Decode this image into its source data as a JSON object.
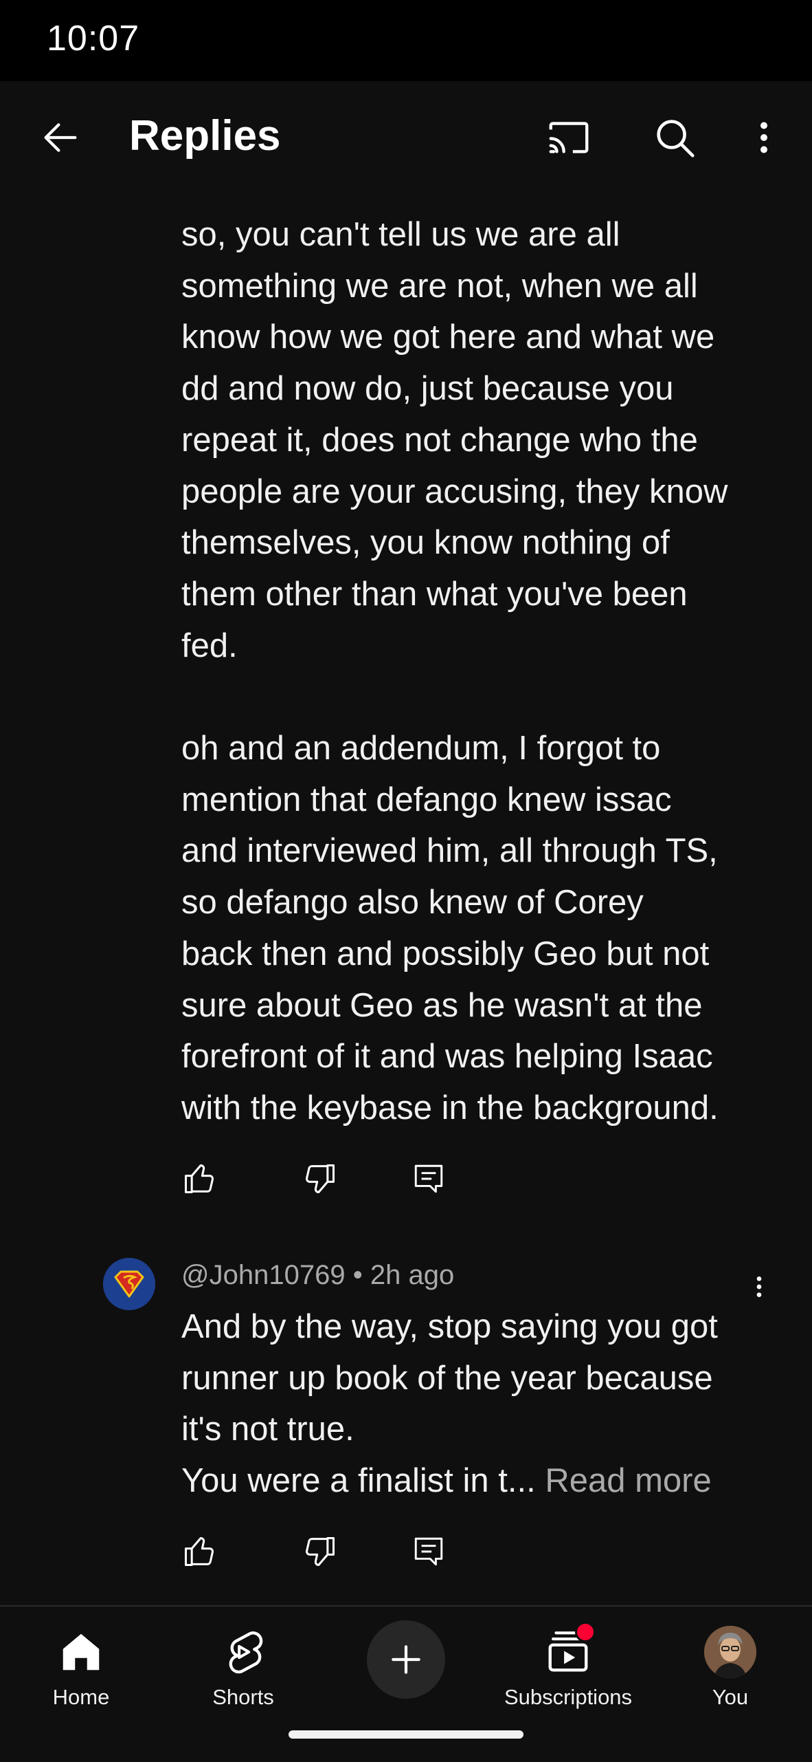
{
  "status_bar": {
    "time": "10:07"
  },
  "header": {
    "title": "Replies",
    "icons": [
      "back-arrow-icon",
      "cast-icon",
      "search-icon",
      "more-vert-icon"
    ]
  },
  "comment_1": {
    "paragraph_1": [
      "so, you can't tell us we are all",
      "something we are not, when we all",
      "know how we got here and what we",
      "dd and now do, just because you",
      "repeat it, does not change who the",
      "people are your accusing, they know",
      "themselves, you know nothing of",
      "them other than what you've been",
      "fed."
    ],
    "paragraph_2": [
      "oh and an addendum, I forgot to",
      "mention that defango knew issac",
      "and interviewed him, all through TS,",
      "so defango also knew of Corey",
      "back then and possibly Geo but not",
      "sure about Geo as he wasn't at the",
      "forefront of it and was helping Isaac",
      "with the keybase in the background."
    ],
    "actions": [
      "like-icon",
      "dislike-icon",
      "reply-icon"
    ]
  },
  "comment_2": {
    "author": "@John10769",
    "separator": "•",
    "time": "2h ago",
    "lines": [
      "And by the way, stop saying you got",
      "runner up book of the year because",
      "it's not true."
    ],
    "last_line": "You were a finalist in t...",
    "read_more": "Read more",
    "actions": [
      "like-icon",
      "dislike-icon",
      "reply-icon"
    ]
  },
  "bottom_nav": {
    "items": [
      {
        "label": "Home",
        "icon": "home-icon"
      },
      {
        "label": "Shorts",
        "icon": "shorts-icon"
      },
      {
        "label": "",
        "icon": "create-plus-icon"
      },
      {
        "label": "Subscriptions",
        "icon": "subscriptions-icon"
      },
      {
        "label": "You",
        "icon": "profile-avatar"
      }
    ]
  },
  "colors": {
    "background": "#0f0f0f",
    "text": "#f1f1f1",
    "secondary_text": "#aaaaaa",
    "notification": "#ff0033"
  }
}
